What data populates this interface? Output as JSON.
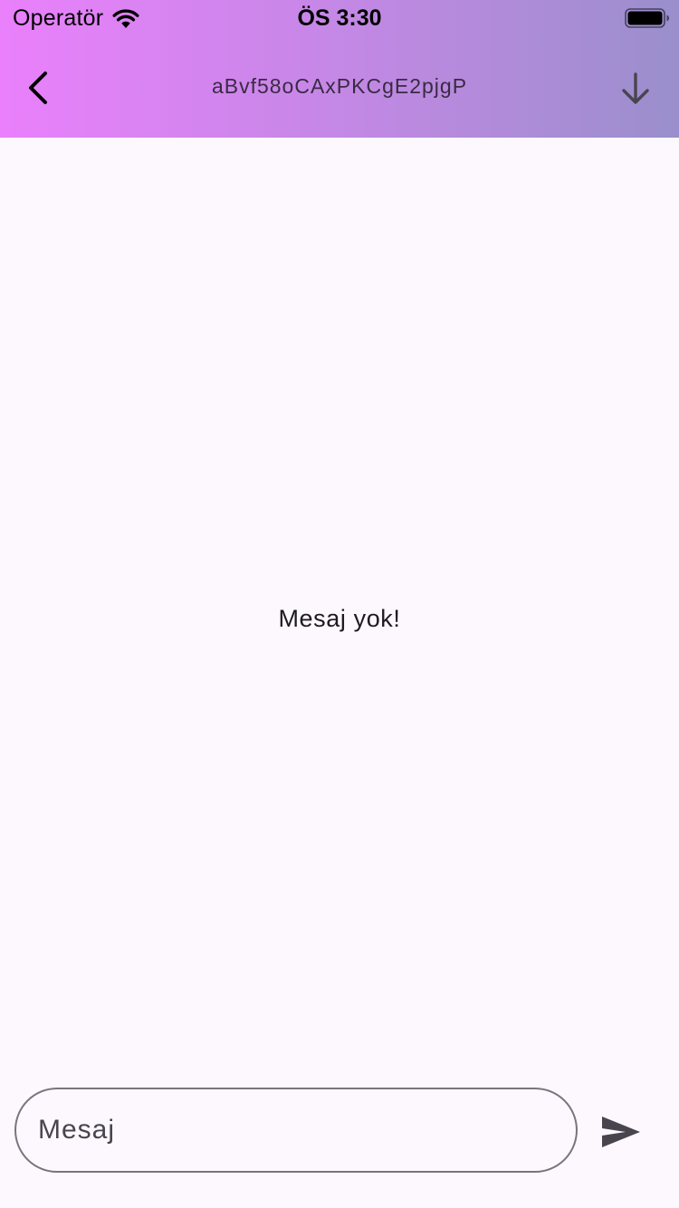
{
  "status_bar": {
    "carrier": "Operatör",
    "time": "ÖS 3:30",
    "wifi_icon": "wifi-icon",
    "battery_icon": "battery-full-icon"
  },
  "nav": {
    "title": "aBvf58oCAxPKCgE2pjgP",
    "back_icon": "chevron-left-icon",
    "download_icon": "arrow-down-icon"
  },
  "chat": {
    "empty_text": "Mesaj yok!"
  },
  "composer": {
    "placeholder": "Mesaj",
    "value": "",
    "send_icon": "send-icon"
  },
  "colors": {
    "header_gradient_start": "#ea80fc",
    "header_gradient_end": "#9a8fcc",
    "background": "#fdf8fd",
    "icon": "#49454f"
  }
}
